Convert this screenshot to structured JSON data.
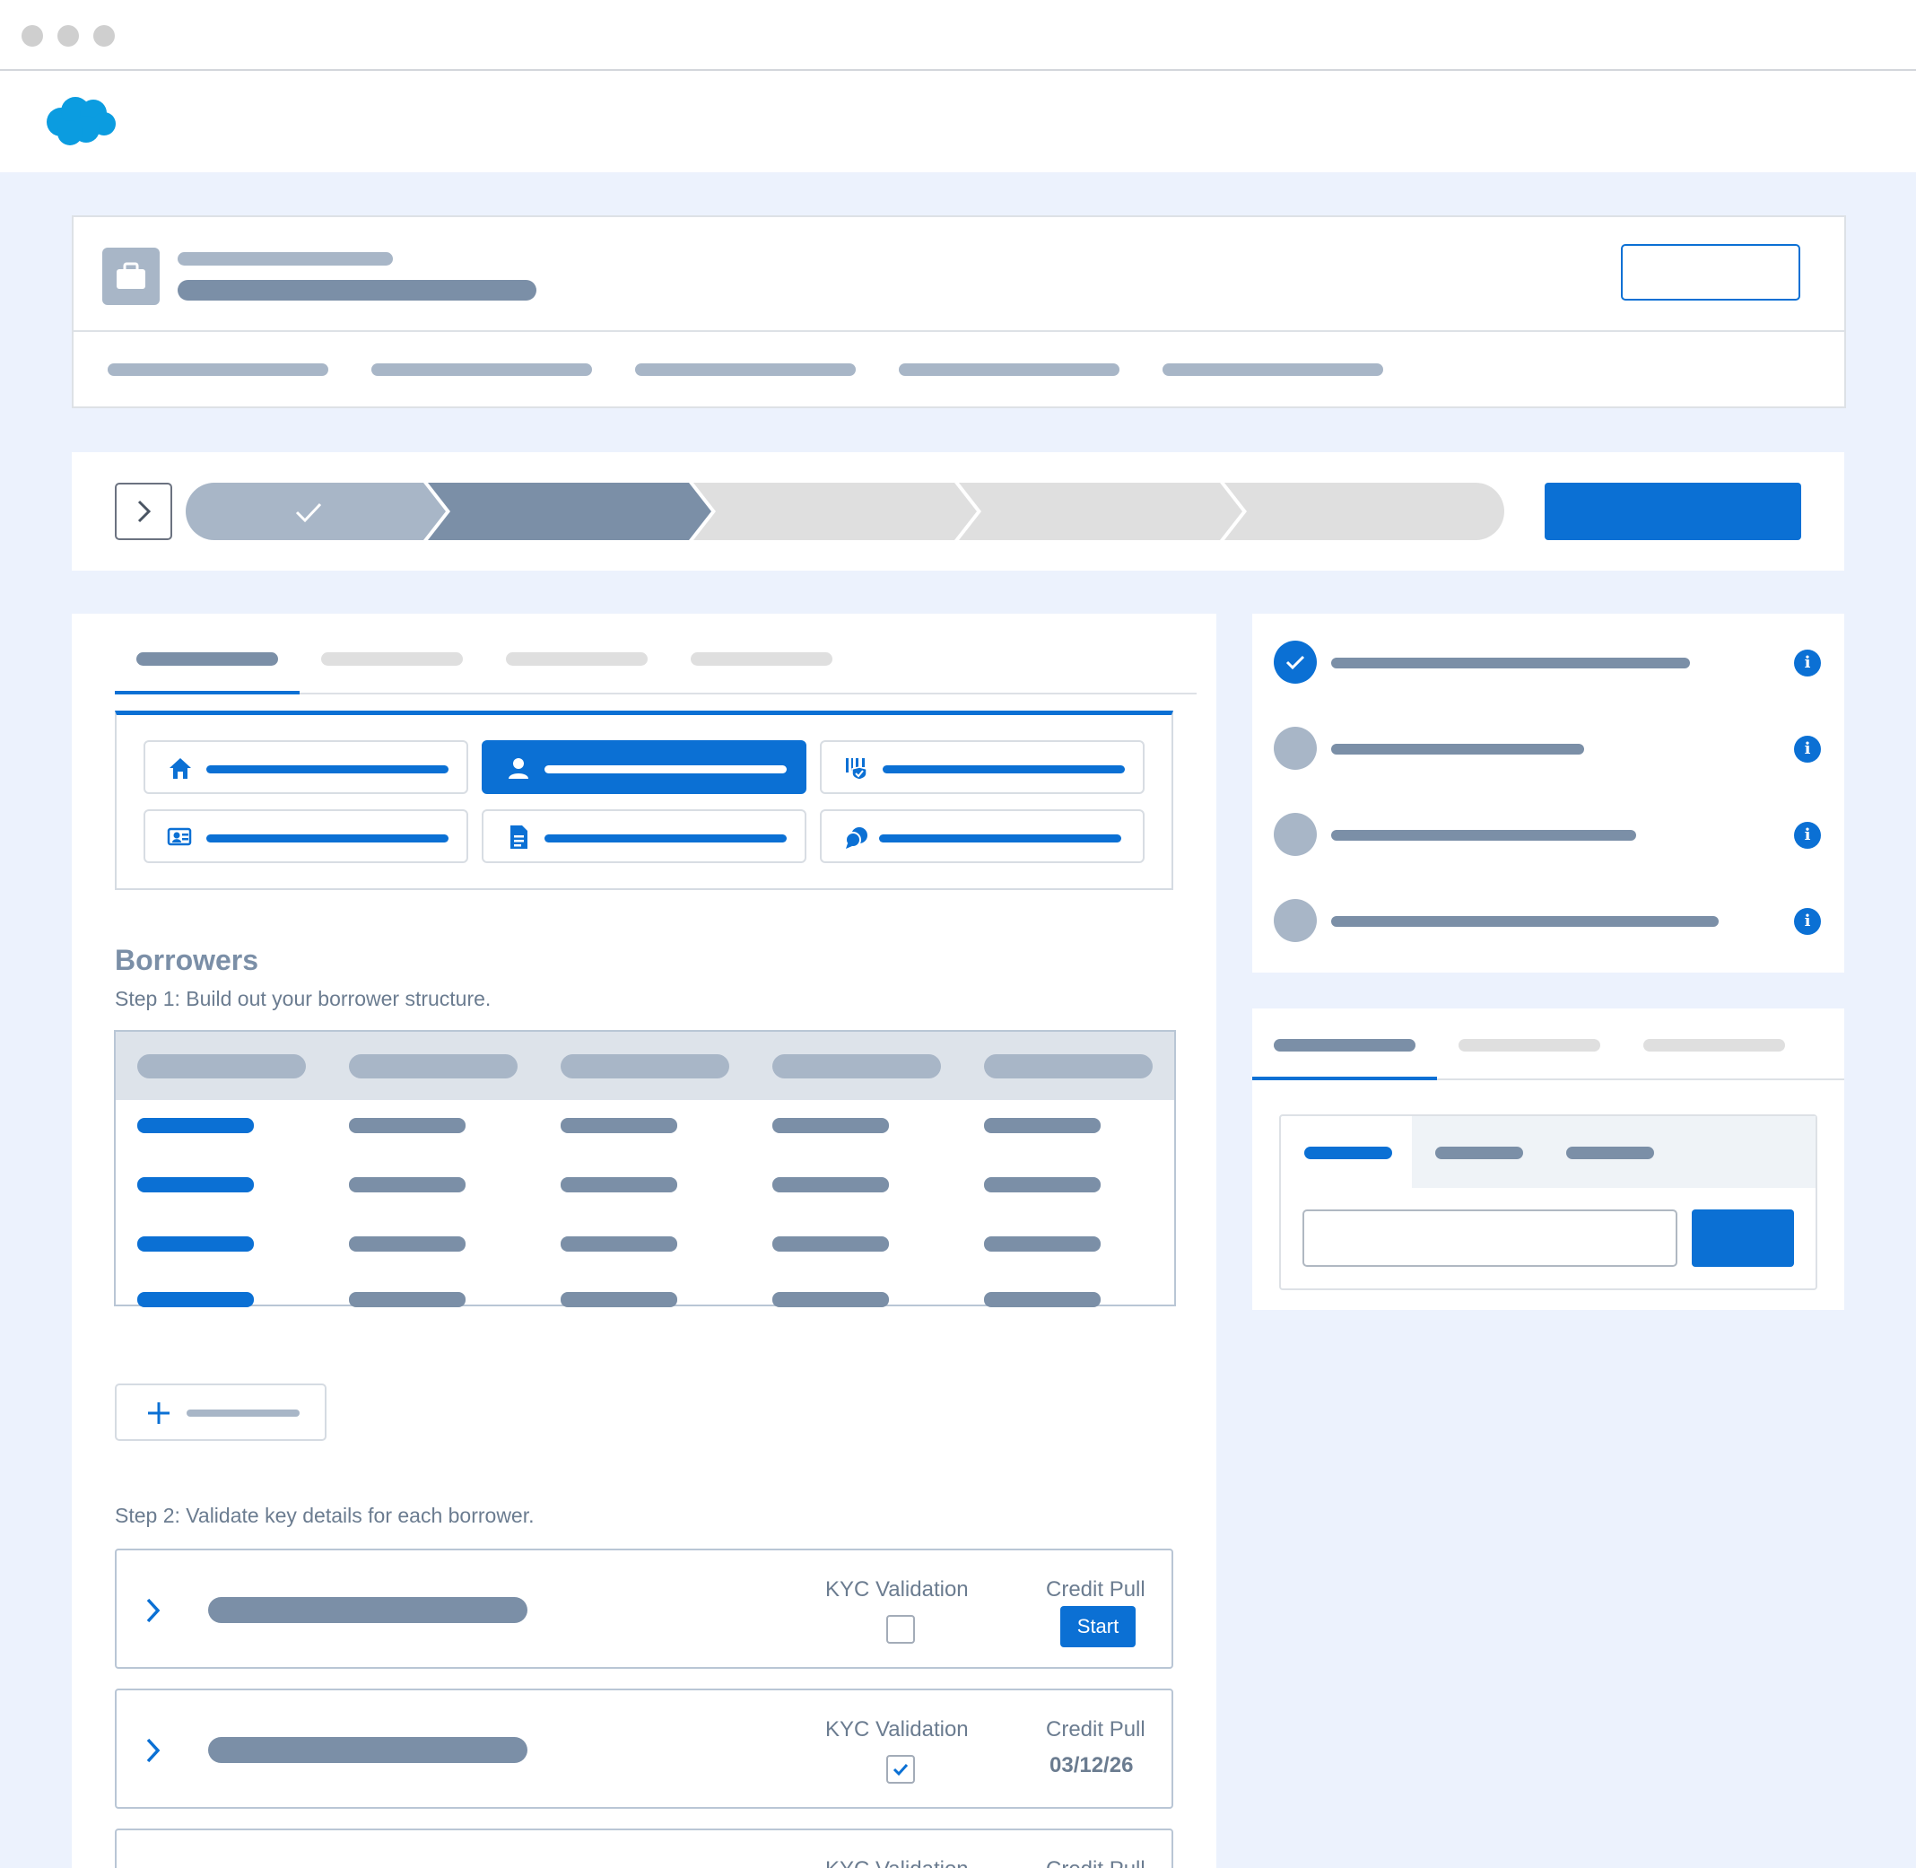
{
  "window": {
    "controls": [
      "close",
      "minimize",
      "maximize"
    ]
  },
  "app": {
    "logo": "salesforce-cloud-logo"
  },
  "borrowers": {
    "title": "Borrowers",
    "step1": "Step 1: Build out your borrower structure.",
    "step2": "Step 2: Validate key details for each borrower.",
    "rows": [
      {
        "kyc_label": "KYC Validation",
        "credit_label": "Credit Pull",
        "kyc_checked": false,
        "credit_button": "Start"
      },
      {
        "kyc_label": "KYC Validation",
        "credit_label": "Credit Pull",
        "kyc_checked": true,
        "credit_date": "03/12/26"
      },
      {
        "kyc_label": "KYC Validation",
        "credit_label": "Credit Pull"
      }
    ]
  },
  "icons": {
    "grid": [
      "home-icon",
      "user-icon",
      "shield-barcode-icon",
      "id-card-icon",
      "document-icon",
      "chat-bubbles-icon"
    ]
  },
  "colors": {
    "accent": "#0b70d4",
    "canvas": "#ecf2fd",
    "placeholder_dark": "#7b8fa7",
    "placeholder_light": "#a8b6c7"
  }
}
